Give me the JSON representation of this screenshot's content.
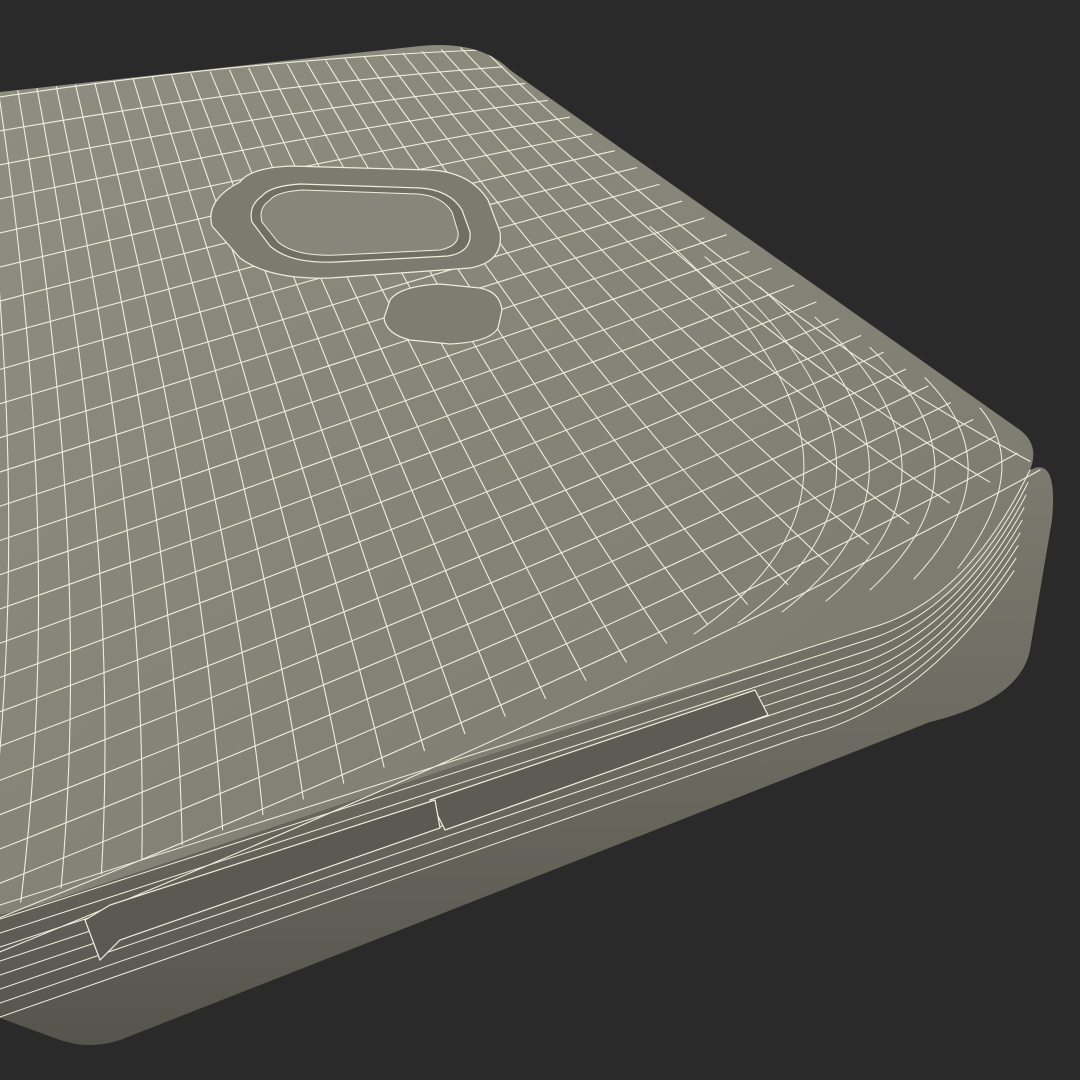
{
  "scene": {
    "subject": "phone-back-wireframe",
    "colors": {
      "background": "#2a2a2a",
      "surface_top": "#8b8b7e",
      "surface_mid": "#7f7f73",
      "surface_side": "#6f6f64",
      "surface_dark": "#5a5a52",
      "wire": "#efeedd"
    }
  }
}
